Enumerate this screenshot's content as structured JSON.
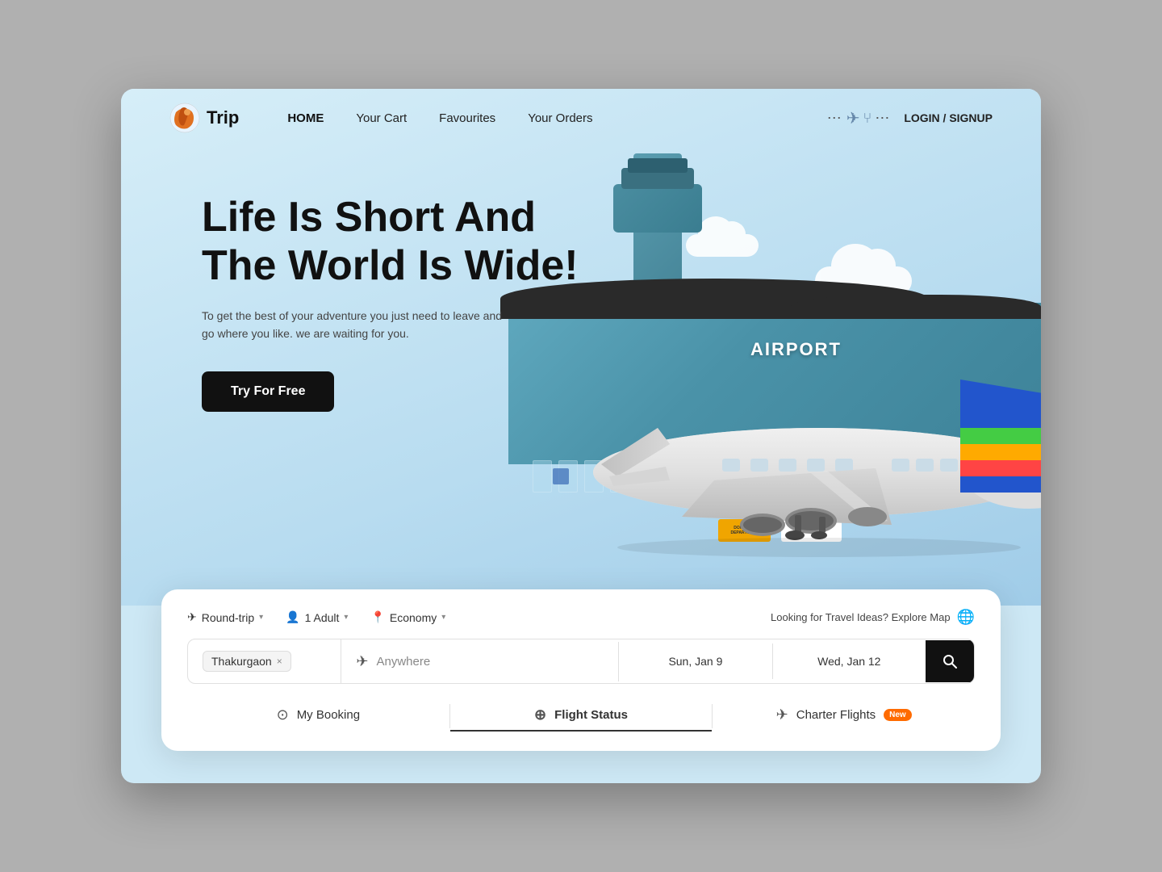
{
  "app": {
    "name": "Trip",
    "logo_alt": "globe-icon"
  },
  "navbar": {
    "home": "HOME",
    "cart": "Your Cart",
    "favourites": "Favourites",
    "orders": "Your Orders",
    "login": "LOGIN / SIGNUP"
  },
  "hero": {
    "title_line1": "Life Is Short And",
    "title_line2": "The World Is Wide!",
    "subtitle": "To get the best of your adventure you just need to leave and go where you like. we are waiting for you.",
    "cta_label": "Try For Free"
  },
  "airport": {
    "label": "AIRPORT"
  },
  "search": {
    "trip_type": "Round-trip",
    "passengers": "1 Adult",
    "class": "Economy",
    "explore_text": "Looking for Travel Ideas? Explore Map",
    "from": "Thakurgaon",
    "to": "Anywhere",
    "date1": "Sun, Jan 9",
    "date2": "Wed, Jan 12"
  },
  "tabs": {
    "booking": "My Booking",
    "flight_status": "Flight Status",
    "charter": "Charter Flights",
    "charter_badge": "New"
  }
}
